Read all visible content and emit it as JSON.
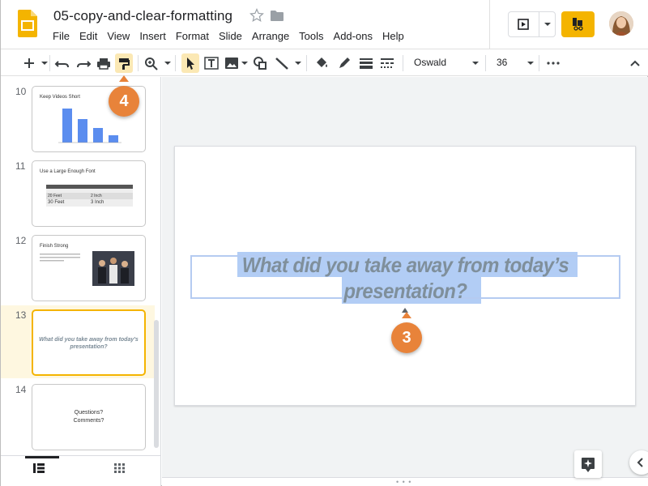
{
  "app": {
    "title": "05-copy-and-clear-formatting",
    "menu": [
      "File",
      "Edit",
      "View",
      "Insert",
      "Format",
      "Slide",
      "Arrange",
      "Tools",
      "Add-ons",
      "Help"
    ]
  },
  "toolbar": {
    "font_name": "Oswald",
    "font_size": "36",
    "icons": [
      "plus-icon",
      "undo-icon",
      "redo-icon",
      "print-icon",
      "paint-format-icon",
      "zoom-icon",
      "select-icon",
      "textbox-icon",
      "image-icon",
      "shape-icon",
      "line-icon",
      "fill-color-icon",
      "border-color-icon",
      "border-weight-icon",
      "border-dash-icon",
      "more-icon",
      "collapse-icon"
    ],
    "accent": "#f4b400"
  },
  "filmstrip": {
    "slides": [
      {
        "num": "10",
        "title": "Keep Videos Short",
        "kind": "chart"
      },
      {
        "num": "11",
        "title": "Use a Large Enough Font",
        "kind": "table",
        "table_rows": [
          [
            "20 Feet",
            "2 Inch"
          ],
          [
            "30 Feet",
            "3 Inch"
          ]
        ]
      },
      {
        "num": "12",
        "title": "Finish Strong",
        "kind": "image"
      },
      {
        "num": "13",
        "title": "What did you take away from today's presentation?",
        "kind": "quote",
        "selected": true
      },
      {
        "num": "14",
        "title": "Questions?\nComments?",
        "kind": "text"
      }
    ]
  },
  "slide": {
    "quote_line1": "What did you take away from today’s",
    "quote_line2": "presentation?"
  },
  "callouts": {
    "paint_format": "4",
    "text_selection": "3",
    "color": "#e8833a"
  },
  "canvas": {
    "handle_dots": "• • •"
  }
}
